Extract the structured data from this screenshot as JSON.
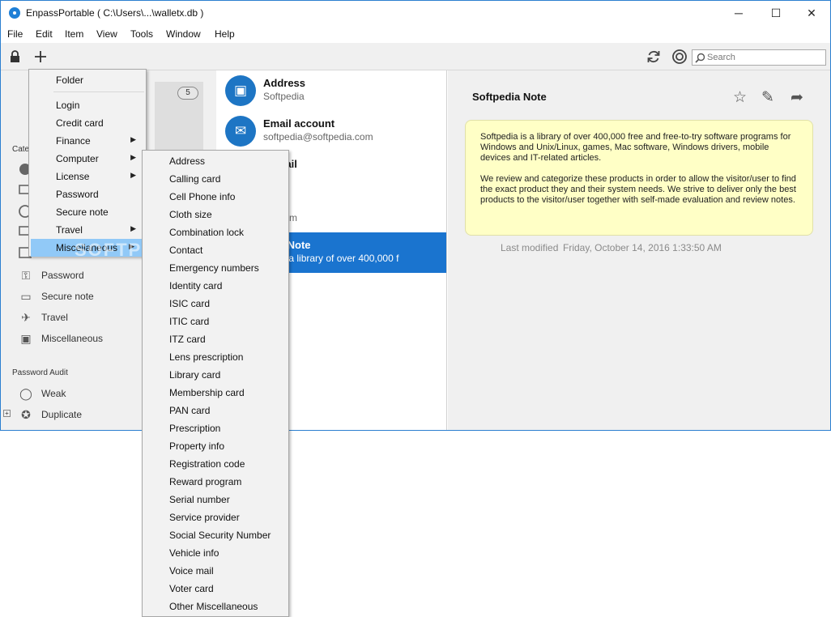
{
  "window": {
    "title": "EnpassPortable ( C:\\Users\\...\\walletx.db )",
    "controls": {
      "minimize": "─",
      "maximize": "☐",
      "close": "✕"
    }
  },
  "menubar": [
    "File",
    "Edit",
    "Item",
    "View",
    "Tools",
    "Window",
    "Help"
  ],
  "toolbar": {
    "lock_icon": "lock-icon",
    "add_icon": "plus-icon",
    "sync_icon": "sync-icon",
    "settings_icon": "gear-icon",
    "search_placeholder": "Search"
  },
  "sidebar": {
    "count": "5",
    "category_label": "Cate",
    "items": [
      {
        "icon": "key-icon",
        "label": "Password"
      },
      {
        "icon": "note-icon",
        "label": "Secure note"
      },
      {
        "icon": "plane-icon",
        "label": "Travel"
      },
      {
        "icon": "briefcase-icon",
        "label": "Miscellaneous"
      }
    ],
    "audit_label": "Password Audit",
    "audit_items": [
      {
        "icon": "weak-icon",
        "label": "Weak"
      },
      {
        "icon": "duplicate-icon",
        "label": "Duplicate"
      }
    ]
  },
  "list": [
    {
      "title": "Address",
      "subtitle": "Softpedia",
      "icon": "address-icon"
    },
    {
      "title": "Email account",
      "subtitle": "softpedia@softpedia.com",
      "icon": "email-icon"
    },
    {
      "title": "t detail",
      "subtitle": "0",
      "icon": "card-icon"
    },
    {
      "title": "word",
      "subtitle": "dia.com",
      "icon": "key-icon"
    },
    {
      "title": "edia Note",
      "subtitle": "dia is a library of over 400,000 f",
      "icon": "note-icon"
    }
  ],
  "detail": {
    "title": "Softpedia Note",
    "note_paragraphs": [
      "Softpedia is a library of over 400,000 free and free-to-try software programs for Windows and Unix/Linux, games, Mac software, Windows drivers, mobile devices and IT-related articles.",
      "We review and categorize these products in order to allow the visitor/user to find the exact product they and their system needs. We strive to deliver only the best products to the visitor/user together with self-made evaluation and review notes."
    ],
    "modified_label": "Last modified",
    "modified_value": "Friday, October 14, 2016 1:33:50 AM"
  },
  "add_menu": {
    "top_item": "Folder",
    "items": [
      {
        "label": "Login",
        "submenu": false
      },
      {
        "label": "Credit card",
        "submenu": false
      },
      {
        "label": "Finance",
        "submenu": true
      },
      {
        "label": "Computer",
        "submenu": true
      },
      {
        "label": "License",
        "submenu": true
      },
      {
        "label": "Password",
        "submenu": false
      },
      {
        "label": "Secure note",
        "submenu": false
      },
      {
        "label": "Travel",
        "submenu": true
      },
      {
        "label": "Miscellaneous",
        "submenu": true,
        "highlighted": true
      }
    ]
  },
  "misc_submenu": [
    "Address",
    "Calling card",
    "Cell Phone info",
    "Cloth size",
    "Combination lock",
    "Contact",
    "Emergency numbers",
    "Identity card",
    "ISIC card",
    "ITIC card",
    "ITZ card",
    "Lens prescription",
    "Library card",
    "Membership card",
    "PAN card",
    "Prescription",
    "Property info",
    "Registration code",
    "Reward program",
    "Serial number",
    "Service provider",
    "Social Security Number",
    "Vehicle info",
    "Voice mail",
    "Voter card",
    "Other Miscellaneous"
  ],
  "watermark": "SOFTPEDIA",
  "colors": {
    "accent": "#1a74cf",
    "note_bg": "#ffffc6",
    "menu_highlight": "#91c9f7"
  }
}
